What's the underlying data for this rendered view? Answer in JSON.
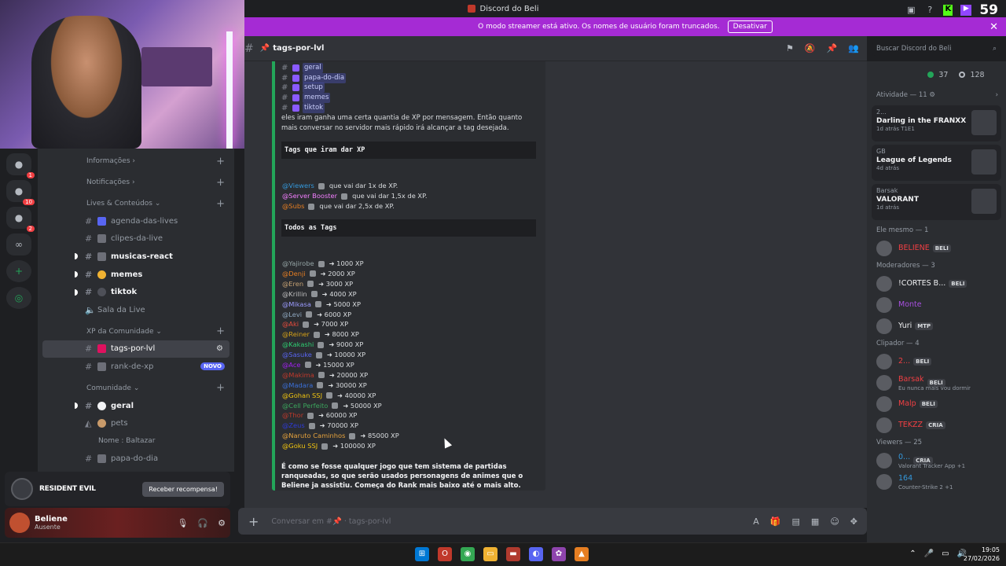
{
  "window": {
    "title": "Discord do Beli",
    "counter": "59"
  },
  "streamer_banner": {
    "text": "O modo streamer está ativo. Os nomes de usuário foram truncados.",
    "button": "Desativar"
  },
  "server_badges": [
    "1",
    "10",
    "2"
  ],
  "channels": {
    "cat_info": "Informações",
    "cat_notif": "Notificações",
    "cat_lives": "Lives & Conteúdos",
    "items_lives": [
      {
        "label": "agenda-das-lives"
      },
      {
        "label": "clipes-da-live"
      },
      {
        "label": "musicas-react"
      },
      {
        "label": "memes"
      },
      {
        "label": "tiktok"
      },
      {
        "label": "Sala da Live"
      }
    ],
    "cat_xp": "XP da Comunidade",
    "tags_por_lvl": "tags-por-lvl",
    "rank_de_xp": "rank-de-xp",
    "novo": "NOVO",
    "cat_comunidade": "Comunidade",
    "geral": "geral",
    "pets": "pets",
    "nome_baltazar": "Nome : Baltazar",
    "papa_do_dia": "papa-do-dia"
  },
  "promo": {
    "game": "RESIDENT EVIL",
    "button": "Receber recompensa!"
  },
  "user": {
    "name": "Beliene",
    "status": "Ausente"
  },
  "chat_header": {
    "channel": "tags-por-lvl",
    "search_placeholder": "Buscar Discord do Beli"
  },
  "embed": {
    "channels": [
      "geral",
      "papa-do-dia",
      "setup",
      "memes",
      "tiktok"
    ],
    "intro": "eles iram ganha uma certa quantia de XP por mensagem. Então quanto mais conversar no servidor mais rápido irá alcançar a tag desejada.",
    "header_tags_xp": "Tags que iram dar XP",
    "xp_roles": [
      {
        "role": "@Viewers",
        "text": "que vai dar 1x de XP.",
        "color": "#3498db"
      },
      {
        "role": "@Server Booster",
        "text": "que vai dar 1,5x de XP.",
        "color": "#f47fff"
      },
      {
        "role": "@Subs",
        "text": "que vai dar 2,5x de XP.",
        "color": "#e67e22"
      }
    ],
    "header_todos": "Todos as Tags",
    "tags": [
      {
        "role": "@Yajirobe",
        "xp": "➜ 1000 XP",
        "color": "#95a5a6"
      },
      {
        "role": "@Denji",
        "xp": "➜ 2000 XP",
        "color": "#e67e22"
      },
      {
        "role": "@Eren",
        "xp": "➜ 3000 XP",
        "color": "#c5a173"
      },
      {
        "role": "@Krillin",
        "xp": "➜ 4000 XP",
        "color": "#bfbfbf"
      },
      {
        "role": "@Mikasa",
        "xp": "➜ 5000 XP",
        "color": "#9b9bff"
      },
      {
        "role": "@Levi",
        "xp": "➜ 6000 XP",
        "color": "#8fa8c0"
      },
      {
        "role": "@Aki",
        "xp": "➜ 7000 XP",
        "color": "#e74c3c"
      },
      {
        "role": "@Reiner",
        "xp": "➜ 8000 XP",
        "color": "#d4a017"
      },
      {
        "role": "@Kakashi",
        "xp": "➜ 9000 XP",
        "color": "#2ecc71"
      },
      {
        "role": "@Sasuke",
        "xp": "➜ 10000 XP",
        "color": "#5865f2"
      },
      {
        "role": "@Ace",
        "xp": "➜ 15000 XP",
        "color": "#a020f0"
      },
      {
        "role": "@Makima",
        "xp": "➜ 20000 XP",
        "color": "#c0392b"
      },
      {
        "role": "@Madara",
        "xp": "➜ 30000 XP",
        "color": "#3a6fd8"
      },
      {
        "role": "@Gohan SSJ",
        "xp": "➜ 40000 XP",
        "color": "#f1c40f"
      },
      {
        "role": "@Cell Perfeito",
        "xp": "➜ 50000 XP",
        "color": "#3ba55d"
      },
      {
        "role": "@Thor",
        "xp": "➜ 60000 XP",
        "color": "#c0392b"
      },
      {
        "role": "@Zeus",
        "xp": "➜ 70000 XP",
        "color": "#2d3ad8"
      },
      {
        "role": "@Naruto Caminhos",
        "xp": "➜ 85000 XP",
        "color": "#e6a23c"
      },
      {
        "role": "@Goku SSJ",
        "xp": "➜ 100000 XP",
        "color": "#f1c40f"
      }
    ],
    "final": "É como se fosse qualquer jogo que tem sistema de partidas ranqueadas, so que serão usados personagens de animes que o Beliene ja assistiu. Começa do Rank mais baixo até o mais alto."
  },
  "composer": {
    "placeholder": "Conversar em #📌 · tags-por-lvl"
  },
  "members": {
    "online_count": "37",
    "offline_count": "128",
    "activity_header": "Atividade — 11",
    "activities": [
      {
        "user": "2...",
        "title": "Darling in the FRANXX",
        "meta": "1d atrás  T1E1"
      },
      {
        "user": "GB",
        "title": "League of Legends",
        "meta": "4d atrás"
      },
      {
        "user": "Barsak",
        "title": "VALORANT",
        "meta": "1d atrás"
      }
    ],
    "sec_ele": "Ele mesmo — 1",
    "ele": [
      {
        "name": "BELIENE",
        "tag": "BELI",
        "color": "#f23f43"
      }
    ],
    "sec_mods": "Moderadores — 3",
    "mods": [
      {
        "name": "!CORTES B...",
        "tag": "BELI",
        "color": "#f2f3f5"
      },
      {
        "name": "Monte",
        "tag": "",
        "color": "#a84fe0"
      },
      {
        "name": "Yuri",
        "tag": "MTP",
        "color": "#f2f3f5"
      }
    ],
    "sec_clip": "Clipador — 4",
    "clip": [
      {
        "name": "2...",
        "tag": "BELI",
        "sub": "",
        "color": "#f23f43"
      },
      {
        "name": "Barsak",
        "tag": "BELI",
        "sub": "Eu nunca mais vou dormir",
        "color": "#f23f43"
      },
      {
        "name": "Malp",
        "tag": "BELI",
        "sub": "",
        "color": "#f23f43"
      },
      {
        "name": "TEKZZ",
        "tag": "CRIA",
        "sub": "",
        "color": "#f23f43"
      }
    ],
    "sec_viewers": "Viewers — 25",
    "viewers": [
      {
        "name": "0...",
        "tag": "CRIA",
        "sub": "Valorant Tracker App +1",
        "color": "#3498db"
      },
      {
        "name": "164",
        "tag": "",
        "sub": "Counter-Strike 2 +1",
        "color": "#3498db"
      }
    ]
  },
  "taskbar": {
    "time": "19:05",
    "date": "27/02/2026"
  }
}
